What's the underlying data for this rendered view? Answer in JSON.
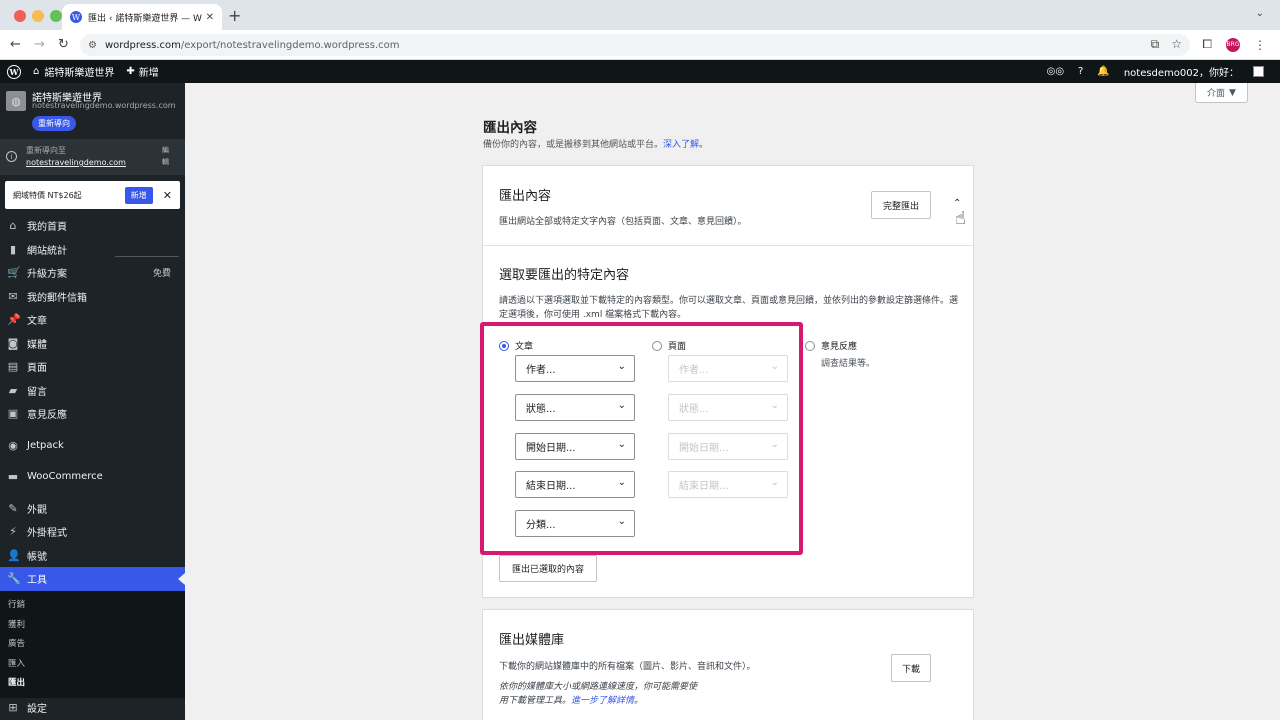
{
  "browser": {
    "tab_title": "匯出 ‹ 諾特斯樂遊世界 — WordPress.com",
    "tab_close": "✕",
    "new_tab": "+",
    "url_host": "wordpress.com",
    "url_path": "/export/notestravelingdemo.wordpress.com",
    "profile_initials": "BRG",
    "chevron": "⌄"
  },
  "adminbar": {
    "site_name": "諾特斯樂遊世界",
    "new_label": "新增",
    "user_greeting": "notesdemo002，你好："
  },
  "sidebar": {
    "site_name": "諾特斯樂遊世界",
    "site_url": "notestravelingdemo.wordpress.com",
    "redirect_badge": "重新導向",
    "redirect_label": "重新導向至",
    "redirect_link": "notestravelingdemo.com",
    "redirect_edit": "編輯",
    "promo_text": "網域特價 NT$26起",
    "promo_button": "新增",
    "menu": [
      {
        "label": "我的首頁",
        "icon": "home-icon",
        "glyph": "⌂"
      },
      {
        "label": "網站統計",
        "icon": "stats-icon",
        "glyph": "▮"
      },
      {
        "label": "升級方案",
        "icon": "cart-icon",
        "glyph": "🛒",
        "extra": "免費"
      },
      {
        "label": "我的郵件信箱",
        "icon": "mail-icon",
        "glyph": "✉"
      },
      {
        "label": "文章",
        "icon": "pin-icon",
        "glyph": "📌"
      },
      {
        "label": "媒體",
        "icon": "media-icon",
        "glyph": "◙"
      },
      {
        "label": "頁面",
        "icon": "page-icon",
        "glyph": "▤"
      },
      {
        "label": "留言",
        "icon": "comment-icon",
        "glyph": "▰"
      },
      {
        "label": "意見反應",
        "icon": "feedback-icon",
        "glyph": "▣"
      },
      {
        "label": "Jetpack",
        "icon": "jetpack-icon",
        "glyph": "◉"
      },
      {
        "label": "WooCommerce",
        "icon": "woo-icon",
        "glyph": "▬"
      },
      {
        "label": "外觀",
        "icon": "brush-icon",
        "glyph": "✎"
      },
      {
        "label": "外掛程式",
        "icon": "plugin-icon",
        "glyph": "⚡"
      },
      {
        "label": "帳號",
        "icon": "user-icon",
        "glyph": "👤"
      },
      {
        "label": "工具",
        "icon": "wrench-icon",
        "glyph": "🔧"
      }
    ],
    "submenu": [
      "行銷",
      "獲利",
      "廣告",
      "匯入",
      "匯出"
    ],
    "settings_label": "設定"
  },
  "main": {
    "screen_options": "介面",
    "page_title": "匯出內容",
    "page_subtitle": "備份你的內容，或是搬移到其他網站或平台。",
    "learn_more": "深入了解",
    "export_card": {
      "title": "匯出內容",
      "description": "匯出網站全部或特定文字內容（包括頁面、文章、意見回饋）。",
      "full_export_button": "完整匯出",
      "section_title": "選取要匯出的特定內容",
      "help_text": "請透過以下選項選取並下載特定的內容類型。你可以選取文章、頁面或意見回饋，並依列出的參數設定篩選條件。選定選項後，你可使用 .xml 檔案格式下載內容。",
      "types": [
        {
          "label": "文章",
          "checked": true
        },
        {
          "label": "頁面",
          "checked": false
        },
        {
          "label": "意見反應",
          "checked": false
        }
      ],
      "feedback_note": "調查結果等。",
      "post_filters": [
        "作者...",
        "狀態...",
        "開始日期...",
        "結束日期...",
        "分類..."
      ],
      "page_filters": [
        "作者...",
        "狀態...",
        "開始日期...",
        "結束日期..."
      ],
      "export_selected_button": "匯出已選取的內容"
    },
    "media_card": {
      "title": "匯出媒體庫",
      "description": "下載你的網站媒體庫中的所有檔案（圖片、影片、音訊和文件）。",
      "note": "依你的媒體庫大小或網路連線速度，你可能需要使用下載管理工具。",
      "note_link": "進一步了解詳情",
      "download_button": "下載"
    }
  },
  "colors": {
    "accent": "#3858e9",
    "highlight": "#d6186f",
    "sidebar_bg": "#1d2327"
  }
}
